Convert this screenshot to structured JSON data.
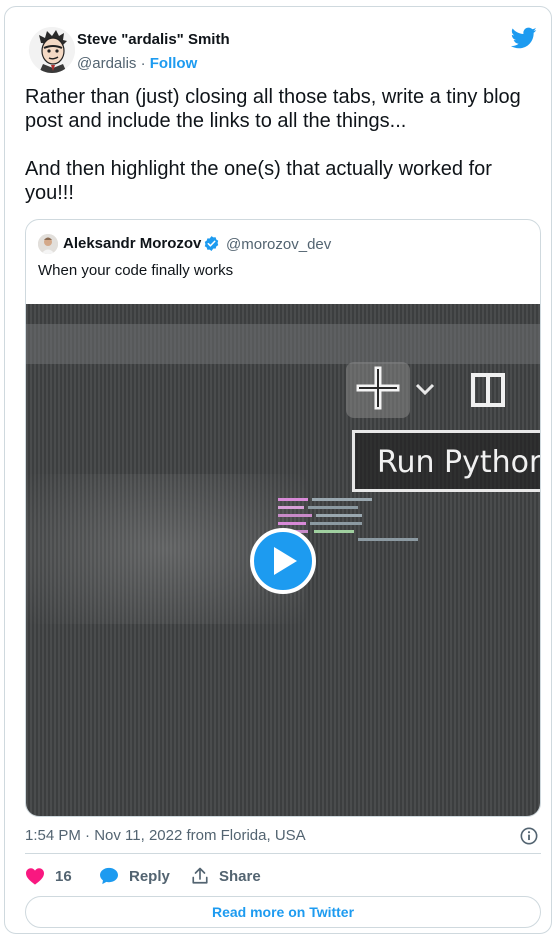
{
  "author": {
    "name": "Steve \"ardalis\" Smith",
    "handle": "@ardalis",
    "separator": " · ",
    "follow_label": "Follow"
  },
  "tweet": {
    "paragraph_1": "Rather than (just) closing all those tabs, write a tiny blog post and include the links to all the things...",
    "paragraph_2": "And then highlight the one(s) that actually worked for you!!!"
  },
  "quoted": {
    "name": "Aleksandr Morozov",
    "handle": "@morozov_dev",
    "text": "When your code finally works",
    "video_button_text": "Run Python"
  },
  "meta": {
    "timestamp": "1:54 PM · Nov 11, 2022 from Florida, USA"
  },
  "actions": {
    "like_count": "16",
    "reply_label": "Reply",
    "share_label": "Share"
  },
  "read_more_label": "Read more on Twitter",
  "icons": {
    "brand": "twitter-bird-icon",
    "verified": "verified-badge-icon",
    "like": "heart-icon",
    "reply": "speech-bubble-icon",
    "share": "share-upload-icon",
    "info": "info-icon",
    "play": "play-icon"
  },
  "colors": {
    "accent": "#1d9bf0",
    "like": "#f91880",
    "text": "#0f1419",
    "muted": "#536471",
    "border": "#cfd9de"
  }
}
